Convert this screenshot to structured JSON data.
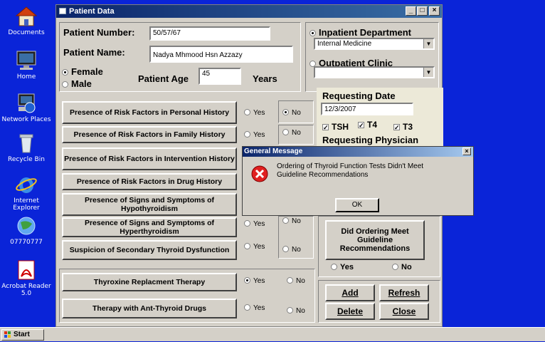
{
  "desktop": {
    "icons": [
      {
        "label": "Documents"
      },
      {
        "label": "Home"
      },
      {
        "label": "Network Places"
      },
      {
        "label": "Recycle Bin"
      },
      {
        "label": "Internet Explorer"
      },
      {
        "label": "07770777"
      },
      {
        "label": "Acrobat Reader 5.0"
      }
    ]
  },
  "window": {
    "title": "Patient Data",
    "controls": {
      "minimize": "_",
      "maximize": "□",
      "close": "×"
    }
  },
  "patient": {
    "number_label": "Patient Number:",
    "number_value": "50/57/67",
    "name_label": "Patient Name:",
    "name_value": "Nadya Mhmood Hsn Azzazy",
    "sex_options": [
      {
        "label": "Female",
        "selected": true
      },
      {
        "label": "Male",
        "selected": false
      }
    ],
    "age_label": "Patient Age",
    "age_value": "45",
    "age_unit": "Years"
  },
  "department": {
    "inpatient_label": "Inpatient Department",
    "inpatient_selected": true,
    "inpatient_value": "Internal Medicine",
    "outpatient_label": "Outpatient Clinic",
    "outpatient_selected": false,
    "outpatient_value": ""
  },
  "requesting": {
    "date_label": "Requesting Date",
    "date_value": "12/3/2007",
    "tests": [
      {
        "label": "TSH",
        "checked": true
      },
      {
        "label": "T4",
        "checked": true
      },
      {
        "label": "T3",
        "checked": true
      }
    ],
    "physician_label": "Requesting Physician"
  },
  "criteria": [
    {
      "label": "Presence of Risk Factors in Personal History",
      "yes": "Yes",
      "no": "No",
      "answer": "no"
    },
    {
      "label": "Presence of Risk Factors in Family History",
      "yes": "Yes",
      "no": "No",
      "answer": ""
    },
    {
      "label": "Presence of Risk Factors in Intervention History",
      "yes": "",
      "no": "",
      "answer": ""
    },
    {
      "label": "Presence of Risk Factors in Drug History",
      "yes": "",
      "no": "",
      "answer": ""
    },
    {
      "label": "Presence of Signs and Symptoms of Hypothyroidism",
      "yes": "",
      "no": "",
      "answer": ""
    },
    {
      "label": "Presence of Signs and Symptoms of Hyperthyroidism",
      "yes": "Yes",
      "no": "No",
      "answer": ""
    },
    {
      "label": "Suspicion of Secondary Thyroid Dysfunction",
      "yes": "Yes",
      "no": "No",
      "answer": ""
    }
  ],
  "therapy": [
    {
      "label": "Thyroxine Replacment Therapy",
      "yes": "Yes",
      "no": "No",
      "answer": "yes"
    },
    {
      "label": "Therapy  with Ant-Thyroid Drugs",
      "yes": "Yes",
      "no": "No",
      "answer": ""
    }
  ],
  "guideline": {
    "button_label": "Did Ordering Meet Guideline Recommendations",
    "yes": "Yes",
    "no": "No"
  },
  "actions": {
    "add": "Add",
    "refresh": "Refresh",
    "delete": "Delete",
    "close": "Close"
  },
  "dialog": {
    "title": "General Message",
    "message": "Ordering of Thyroid Function Tests Didn't Meet Guideline Recommendations",
    "ok": "OK",
    "close": "×"
  },
  "taskbar": {
    "start": "Start"
  }
}
